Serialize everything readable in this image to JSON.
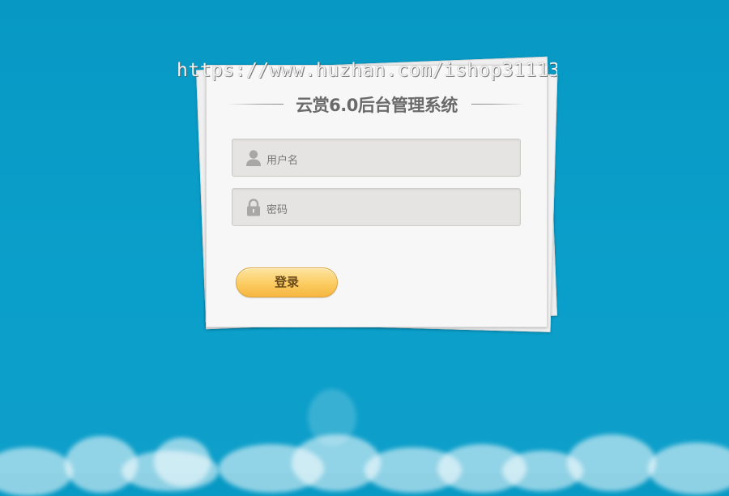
{
  "watermark": "https://www.huzhan.com/ishop31113",
  "title": "云赏6.0后台管理系统",
  "username": {
    "placeholder": "用户名",
    "icon": "user-icon"
  },
  "password": {
    "placeholder": "密码",
    "icon": "lock-icon"
  },
  "login_label": "登录",
  "colors": {
    "background": "#0a9ec8",
    "button": "#fbcc61",
    "field": "#e6e4e2"
  }
}
